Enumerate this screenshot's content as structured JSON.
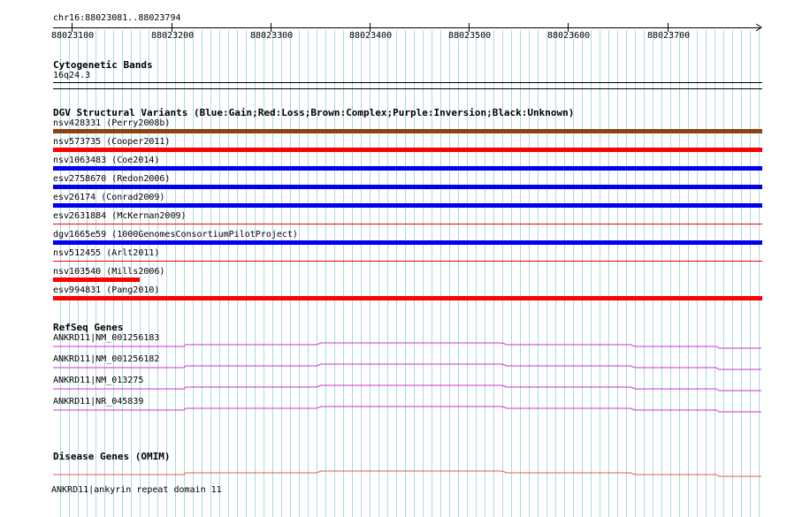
{
  "region": {
    "label": "chr16:88023081..88023794",
    "start": 88023081,
    "end": 88023794
  },
  "ruler": {
    "ticks": [
      "88023100",
      "88023200",
      "88023300",
      "88023400",
      "88023500",
      "88023600",
      "88023700"
    ]
  },
  "cyto": {
    "title": "Cytogenetic Bands",
    "band": "16q24.3"
  },
  "dgv": {
    "title": "DGV Structural Variants (Blue:Gain;Red:Loss;Brown:Complex;Purple:Inversion;Black:Unknown)",
    "colors": {
      "gain": "#0000ee",
      "loss": "#ff0000",
      "complex": "#8b4513"
    },
    "items": [
      {
        "label": "nsv428331 (Perry2008b)",
        "type": "complex",
        "thick": true,
        "extent": "full"
      },
      {
        "label": "nsv573735 (Cooper2011)",
        "type": "loss",
        "thick": true,
        "extent": "full"
      },
      {
        "label": "nsv1063483 (Coe2014)",
        "type": "gain",
        "thick": true,
        "extent": "full"
      },
      {
        "label": "esv2758670 (Redon2006)",
        "type": "gain",
        "thick": true,
        "extent": "full"
      },
      {
        "label": "esv26174 (Conrad2009)",
        "type": "gain",
        "thick": true,
        "extent": "full"
      },
      {
        "label": "esv2631884 (McKernan2009)",
        "type": "loss",
        "thick": false,
        "extent": "full"
      },
      {
        "label": "dgv1665e59 (1000GenomesConsortiumPilotProject)",
        "type": "gain",
        "thick": true,
        "extent": "full"
      },
      {
        "label": "nsv512455 (Arlt2011)",
        "type": "loss",
        "thick": false,
        "extent": "full"
      },
      {
        "label": "nsv103540 (Mills2006)",
        "type": "loss",
        "thick": true,
        "extent": "short"
      },
      {
        "label": "esv994831 (Pang2010)",
        "type": "loss",
        "thick": true,
        "extent": "full"
      }
    ]
  },
  "refseq": {
    "title": "RefSeq Genes",
    "color": "#cc33cc",
    "items": [
      {
        "label": "ANKRD11|NM_001256183"
      },
      {
        "label": "ANKRD11|NM_001256182"
      },
      {
        "label": "ANKRD11|NM_013275"
      },
      {
        "label": "ANKRD11|NR_045839"
      }
    ]
  },
  "omim": {
    "title": "Disease Genes (OMIM)",
    "color": "#e06040",
    "items": [
      {
        "label": "ANKRD11|ankyrin repeat domain 11"
      }
    ]
  },
  "gridColor": "#a8d8ea"
}
